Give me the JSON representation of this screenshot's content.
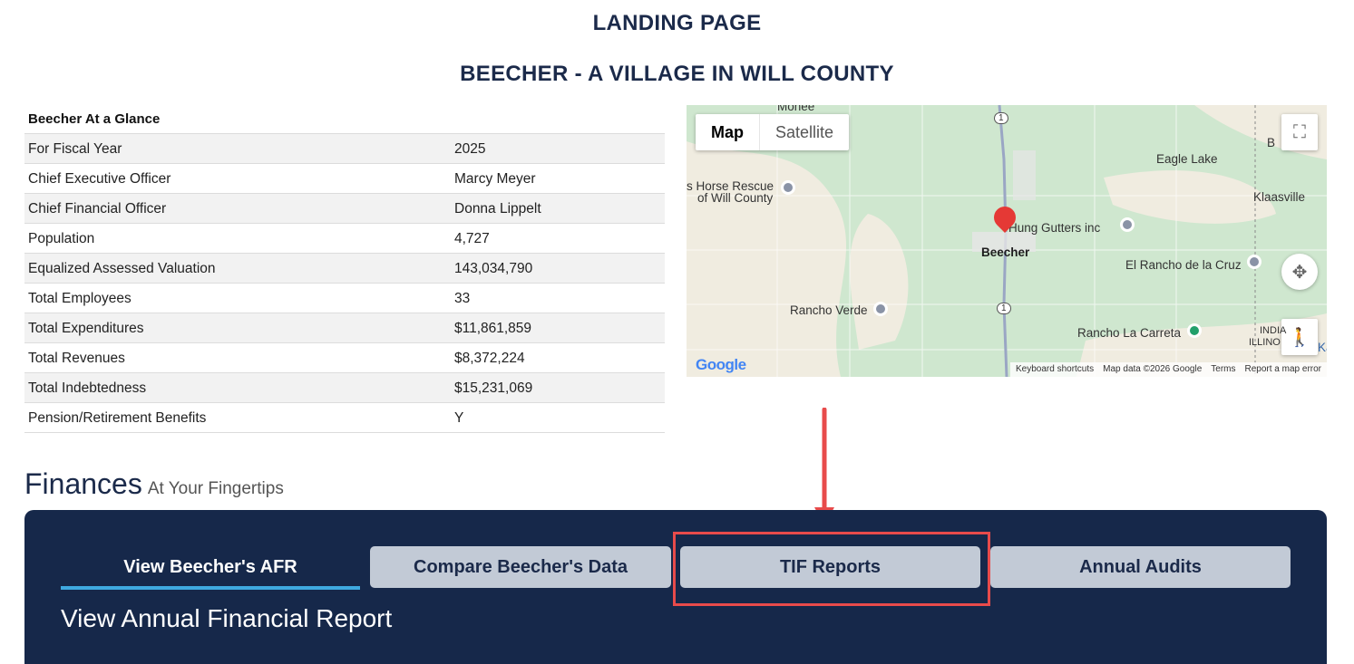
{
  "header": {
    "title": "LANDING PAGE",
    "subtitle": "BEECHER - A VILLAGE IN WILL COUNTY"
  },
  "glance": {
    "heading": "Beecher At a Glance",
    "rows": [
      {
        "label": "For Fiscal Year",
        "value": "2025"
      },
      {
        "label": "Chief Executive Officer",
        "value": "Marcy Meyer"
      },
      {
        "label": "Chief Financial Officer",
        "value": "Donna Lippelt"
      },
      {
        "label": "Population",
        "value": "4,727"
      },
      {
        "label": "Equalized Assessed Valuation",
        "value": "143,034,790"
      },
      {
        "label": "Total Employees",
        "value": "33"
      },
      {
        "label": "Total Expenditures",
        "value": "$11,861,859"
      },
      {
        "label": "Total Revenues",
        "value": "$8,372,224"
      },
      {
        "label": "Total Indebtedness",
        "value": "$15,231,069"
      },
      {
        "label": "Pension/Retirement Benefits",
        "value": "Y"
      }
    ]
  },
  "map": {
    "type_map": "Map",
    "type_satellite": "Satellite",
    "labels": {
      "monee": "Monee",
      "horse_rescue": "s Horse Rescue",
      "of_will_county": "of Will County",
      "eagle_lake": "Eagle Lake",
      "klaasville": "Klaasville",
      "hung_gutters": "Hung Gutters inc",
      "beecher": "Beecher",
      "el_rancho": "El Rancho de la Cruz",
      "rancho_verde": "Rancho Verde",
      "rancho_carreta": "Rancho La Carreta",
      "indiana": "INDIA",
      "illinois": "ILLINO",
      "edge_top": "B",
      "edge_bottom": "Ka",
      "route": "1"
    },
    "google": "Google",
    "footer": {
      "shortcuts": "Keyboard shortcuts",
      "mapdata": "Map data ©2026 Google",
      "terms": "Terms",
      "report": "Report a map error"
    }
  },
  "finances": {
    "title": "Finances",
    "subtitle": "At Your Fingertips",
    "tabs": [
      {
        "label": "View Beecher's AFR"
      },
      {
        "label": "Compare Beecher's Data"
      },
      {
        "label": "TIF Reports"
      },
      {
        "label": "Annual Audits"
      }
    ],
    "panel_title": "View Annual Financial Report"
  },
  "colors": {
    "navy": "#16284a",
    "accent": "#3fa9e0",
    "highlight": "#e84b4b"
  }
}
